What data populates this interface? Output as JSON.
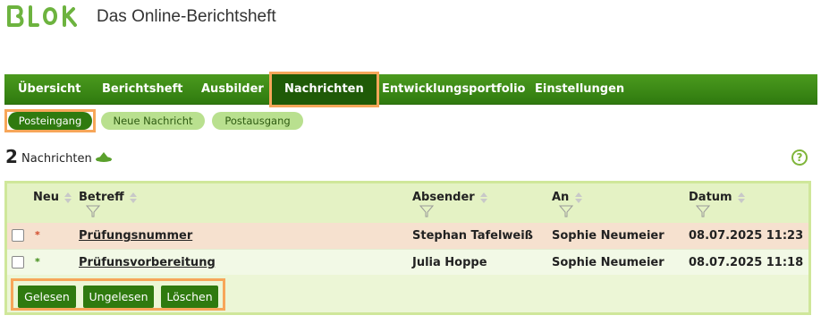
{
  "app": {
    "title": "Das Online-Berichtsheft",
    "brand_color": "#3d8a14",
    "highlight_color": "#f7a659"
  },
  "mainnav": {
    "items": [
      {
        "label": "Übersicht"
      },
      {
        "label": "Berichtsheft"
      },
      {
        "label": "Ausbilder"
      },
      {
        "label": "Nachrichten",
        "active": true
      },
      {
        "label": "Entwicklungsportfolio"
      },
      {
        "label": "Einstellungen"
      }
    ]
  },
  "subnav": {
    "items": [
      {
        "label": "Posteingang",
        "active": true
      },
      {
        "label": "Neue Nachricht"
      },
      {
        "label": "Postausgang"
      }
    ]
  },
  "summary": {
    "count": "2",
    "label": "Nachrichten",
    "help": "?"
  },
  "table": {
    "columns": {
      "neu": "Neu",
      "betreff": "Betreff",
      "absender": "Absender",
      "an": "An",
      "datum": "Datum"
    },
    "rows": [
      {
        "neu": "*",
        "betreff": "Prüfungsnummer",
        "absender": "Stephan Tafelweiß",
        "an": "Sophie Neumeier",
        "datum": "08.07.2025 11:23"
      },
      {
        "neu": "*",
        "betreff": "Prüfunsvorbereitung",
        "absender": "Julia Hoppe",
        "an": "Sophie Neumeier",
        "datum": "08.07.2025 11:18"
      }
    ]
  },
  "actions": {
    "read": "Gelesen",
    "unread": "Ungelesen",
    "delete": "Löschen"
  }
}
